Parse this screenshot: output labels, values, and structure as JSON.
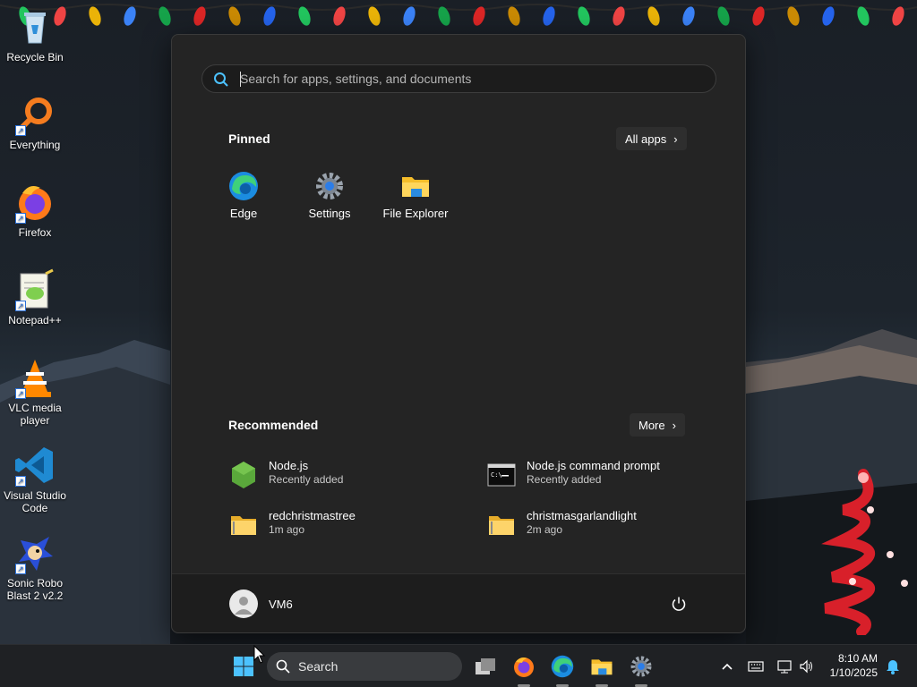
{
  "desktop": {
    "icons": [
      {
        "label": "Recycle Bin",
        "icon": "recycle-bin-icon"
      },
      {
        "label": "Everything",
        "icon": "everything-search-icon"
      },
      {
        "label": "Firefox",
        "icon": "firefox-icon"
      },
      {
        "label": "Notepad++",
        "icon": "notepad-plus-plus-icon"
      },
      {
        "label": "VLC media player",
        "icon": "vlc-icon"
      },
      {
        "label": "Visual Studio Code",
        "icon": "vscode-icon"
      },
      {
        "label": "Sonic Robo Blast 2 v2.2",
        "icon": "sonic-icon"
      }
    ]
  },
  "start_menu": {
    "search_placeholder": "Search for apps, settings, and documents",
    "pinned_title": "Pinned",
    "all_apps_label": "All apps",
    "pinned": [
      {
        "label": "Edge",
        "icon": "edge-icon"
      },
      {
        "label": "Settings",
        "icon": "settings-gear-icon"
      },
      {
        "label": "File Explorer",
        "icon": "folder-icon"
      }
    ],
    "recommended_title": "Recommended",
    "more_label": "More",
    "recommended": [
      {
        "name": "Node.js",
        "sub": "Recently added",
        "icon": "nodejs-icon"
      },
      {
        "name": "Node.js command prompt",
        "sub": "Recently added",
        "icon": "command-prompt-icon"
      },
      {
        "name": "redchristmastree",
        "sub": "1m ago",
        "icon": "zip-folder-icon"
      },
      {
        "name": "christmasgarlandlight",
        "sub": "2m ago",
        "icon": "zip-folder-icon"
      }
    ],
    "user_name": "VM6"
  },
  "taskbar": {
    "search_label": "Search",
    "time": "8:10 AM",
    "date": "1/10/2025"
  },
  "colors": {
    "menu_bg": "#242424",
    "taskbar_bg": "#1f2124",
    "accent": "#4cc2ff"
  }
}
